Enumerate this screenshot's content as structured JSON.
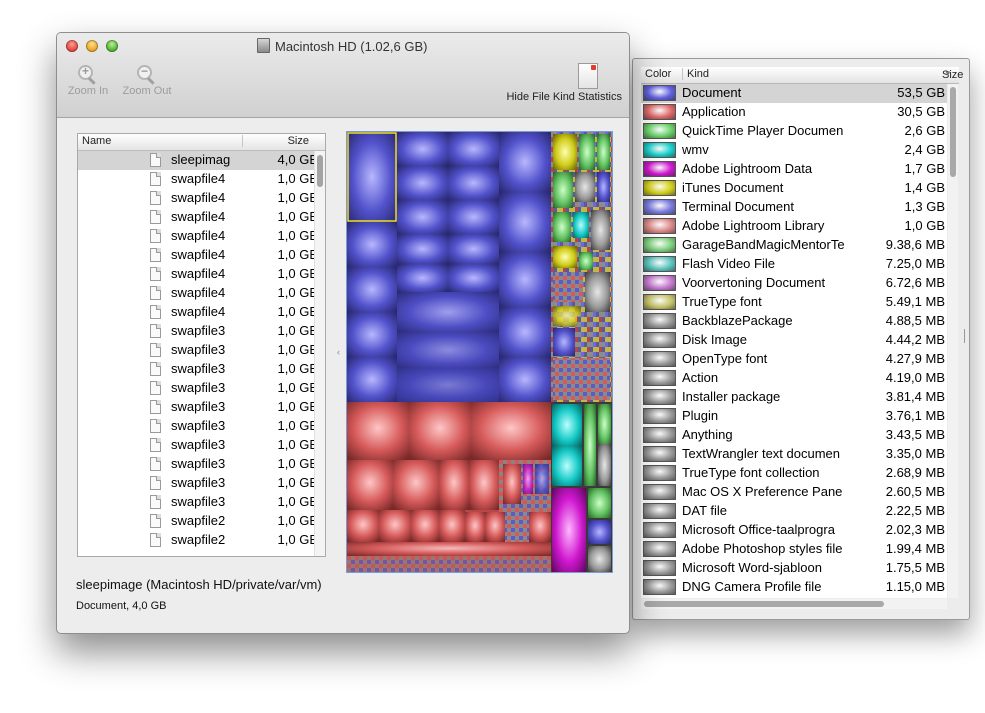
{
  "main_window": {
    "title": "Macintosh HD (1.02,6 GB)",
    "toolbar": {
      "zoom_in": "Zoom In",
      "zoom_out": "Zoom Out",
      "hide_stats": "Hide File Kind Statistics"
    },
    "file_list": {
      "col_name": "Name",
      "col_size": "Size",
      "rows": [
        {
          "name": "sleepimag",
          "size": "4,0 GB",
          "selected": true
        },
        {
          "name": "swapfile4",
          "size": "1,0 GB"
        },
        {
          "name": "swapfile4",
          "size": "1,0 GB"
        },
        {
          "name": "swapfile4",
          "size": "1,0 GB"
        },
        {
          "name": "swapfile4",
          "size": "1,0 GB"
        },
        {
          "name": "swapfile4",
          "size": "1,0 GB"
        },
        {
          "name": "swapfile4",
          "size": "1,0 GB"
        },
        {
          "name": "swapfile4",
          "size": "1,0 GB"
        },
        {
          "name": "swapfile4",
          "size": "1,0 GB"
        },
        {
          "name": "swapfile3",
          "size": "1,0 GB"
        },
        {
          "name": "swapfile3",
          "size": "1,0 GB"
        },
        {
          "name": "swapfile3",
          "size": "1,0 GB"
        },
        {
          "name": "swapfile3",
          "size": "1,0 GB"
        },
        {
          "name": "swapfile3",
          "size": "1,0 GB"
        },
        {
          "name": "swapfile3",
          "size": "1,0 GB"
        },
        {
          "name": "swapfile3",
          "size": "1,0 GB"
        },
        {
          "name": "swapfile3",
          "size": "1,0 GB"
        },
        {
          "name": "swapfile3",
          "size": "1,0 GB"
        },
        {
          "name": "swapfile3",
          "size": "1,0 GB"
        },
        {
          "name": "swapfile2",
          "size": "1,0 GB"
        },
        {
          "name": "swapfile2",
          "size": "1,0 GB"
        }
      ]
    },
    "selection_path": "sleepimage (Macintosh HD/private/var/vm)",
    "selection_kind": "Document, 4,0 GB"
  },
  "kind_window": {
    "col_color": "Color",
    "col_kind": "Kind",
    "col_size": "Size",
    "rows": [
      {
        "color": "#6161e0",
        "kind": "Document",
        "size": "53,5 GB",
        "selected": true
      },
      {
        "color": "#e06a6a",
        "kind": "Application",
        "size": "30,5 GB"
      },
      {
        "color": "#6ad36a",
        "kind": "QuickTime Player Documen",
        "size": "2,6 GB"
      },
      {
        "color": "#17d0cc",
        "kind": "wmv",
        "size": "2,4 GB"
      },
      {
        "color": "#d017d0",
        "kind": "Adobe Lightroom Data",
        "size": "1,7 GB"
      },
      {
        "color": "#d4d017",
        "kind": "iTunes Document",
        "size": "1,4 GB"
      },
      {
        "color": "#7a7ae0",
        "kind": "Terminal Document",
        "size": "1,3 GB"
      },
      {
        "color": "#e08a8a",
        "kind": "Adobe Lightroom Library",
        "size": "1,0 GB"
      },
      {
        "color": "#7ed37e",
        "kind": "GarageBandMagicMentorTe",
        "size": "9.38,6 MB"
      },
      {
        "color": "#5cc6c0",
        "kind": "Flash Video File",
        "size": "7.25,0 MB"
      },
      {
        "color": "#c77ad0",
        "kind": "Voorvertoning Document",
        "size": "6.72,6 MB"
      },
      {
        "color": "#c8c46a",
        "kind": "TrueType font",
        "size": "5.49,1 MB"
      },
      {
        "color": "#9a9a9a",
        "kind": "BackblazePackage",
        "size": "4.88,5 MB"
      },
      {
        "color": "#9a9a9a",
        "kind": "Disk Image",
        "size": "4.44,2 MB"
      },
      {
        "color": "#9a9a9a",
        "kind": "OpenType font",
        "size": "4.27,9 MB"
      },
      {
        "color": "#9a9a9a",
        "kind": "Action",
        "size": "4.19,0 MB"
      },
      {
        "color": "#9a9a9a",
        "kind": "Installer package",
        "size": "3.81,4 MB"
      },
      {
        "color": "#9a9a9a",
        "kind": "Plugin",
        "size": "3.76,1 MB"
      },
      {
        "color": "#9a9a9a",
        "kind": "Anything",
        "size": "3.43,5 MB"
      },
      {
        "color": "#9a9a9a",
        "kind": "TextWrangler text documen",
        "size": "3.35,0 MB"
      },
      {
        "color": "#9a9a9a",
        "kind": "TrueType font collection",
        "size": "2.68,9 MB"
      },
      {
        "color": "#9a9a9a",
        "kind": "Mac OS X Preference Pane",
        "size": "2.60,5 MB"
      },
      {
        "color": "#9a9a9a",
        "kind": "DAT file",
        "size": "2.22,5 MB"
      },
      {
        "color": "#9a9a9a",
        "kind": "Microsoft Office-taalprogra",
        "size": "2.02,3 MB"
      },
      {
        "color": "#9a9a9a",
        "kind": "Adobe Photoshop styles file",
        "size": "1.99,4 MB"
      },
      {
        "color": "#9a9a9a",
        "kind": "Microsoft Word-sjabloon",
        "size": "1.75,5 MB"
      },
      {
        "color": "#9a9a9a",
        "kind": "DNG Camera Profile file",
        "size": "1.15,0 MB"
      }
    ]
  },
  "colors": {
    "document": "#5a5ad8",
    "application": "#dc6464",
    "selection_outline": "#f0e020"
  }
}
